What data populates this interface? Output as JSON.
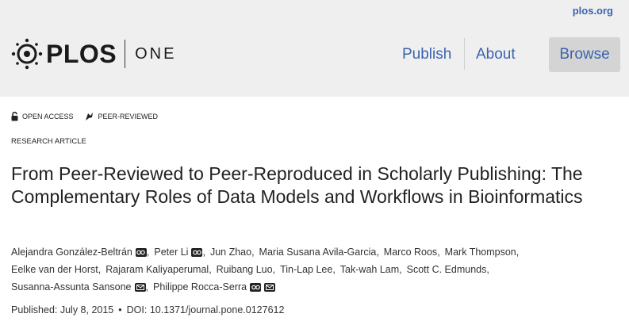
{
  "header": {
    "site_link": "plos.org",
    "logo_text": "PLOS",
    "logo_journal": "ONE",
    "nav": {
      "publish": "Publish",
      "about": "About",
      "browse": "Browse"
    }
  },
  "badges": {
    "open_access": "OPEN ACCESS",
    "peer_reviewed": "PEER-REVIEWED"
  },
  "article": {
    "type": "RESEARCH ARTICLE",
    "title": "From Peer-Reviewed to Peer-Reproduced in Scholarly Publishing: The Complementary Roles of Data Models and Workflows in Bioinformatics",
    "authors_line1": [
      {
        "name": "Alejandra González-Beltrán",
        "orcid": true,
        "mail": false
      },
      {
        "name": "Peter Li",
        "orcid": true,
        "mail": false
      },
      {
        "name": "Jun Zhao",
        "orcid": false,
        "mail": false
      },
      {
        "name": "Maria Susana Avila-Garcia",
        "orcid": false,
        "mail": false
      },
      {
        "name": "Marco Roos",
        "orcid": false,
        "mail": false
      },
      {
        "name": "Mark Thompson",
        "orcid": false,
        "mail": false
      }
    ],
    "authors_line2": [
      {
        "name": "Eelke van der Horst",
        "orcid": false,
        "mail": false
      },
      {
        "name": "Rajaram Kaliyaperumal",
        "orcid": false,
        "mail": false
      },
      {
        "name": "Ruibang Luo",
        "orcid": false,
        "mail": false
      },
      {
        "name": "Tin-Lap Lee",
        "orcid": false,
        "mail": false
      },
      {
        "name": "Tak-wah Lam",
        "orcid": false,
        "mail": false
      },
      {
        "name": "Scott C. Edmunds",
        "orcid": false,
        "mail": false
      }
    ],
    "authors_line3": [
      {
        "name": "Susanna-Assunta Sansone",
        "orcid": false,
        "mail": true
      },
      {
        "name": "Philippe Rocca-Serra",
        "orcid": true,
        "mail": true
      }
    ],
    "published_label": "Published: July 8, 2015",
    "bullet": "•",
    "doi_label": "DOI: 10.1371/journal.pone.0127612"
  },
  "colors": {
    "link": "#3c63af",
    "header_bg": "#efefef",
    "browse_bg": "#d4d4d4"
  },
  "icons": [
    "plos-logo-icon",
    "open-lock-icon",
    "peer-reviewed-icon",
    "orcid-icon",
    "mail-icon"
  ]
}
